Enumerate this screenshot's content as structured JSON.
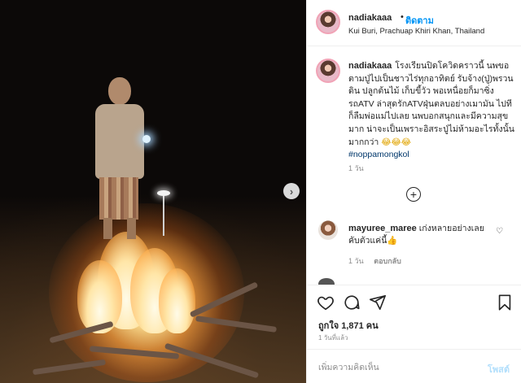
{
  "post": {
    "username": "nadiakaaa",
    "follow_label": "ติดตาม",
    "location": "Kui Buri, Prachuap Khiri Khan, Thailand",
    "caption_text": "โรงเรียนปิดโควิดคราวนี้ นพขอตามปู่ไปเป็นชาวไร่ทุกอาทิตย์ รับจ้าง(ปู่)พรวนดิน ปลูกต้นไม้ เก็บขี้วัว พอเหนื่อยก็มาซิ่งรถATV ล่าสุดรักATVฝุ่นตลบอย่างเมามัน ไปทีก็ลืมพ่อแม่ไปเลย นพบอกสนุกและมีความสุขมาก น่าจะเป็นเพราะอิสระปู่ไม่ห้ามอะไรทั้งนั้นมากกว่า",
    "caption_emoji": "😂😂😂",
    "hashtag": "#noppamongkol",
    "time_ago": "1 วัน"
  },
  "comment": {
    "username": "mayuree_maree",
    "text": "เก่งหลายอย่างเลยคับตัวแค่นี้👍",
    "time": "1 วัน",
    "reply_label": "ตอบกลับ"
  },
  "footer": {
    "likes": "ถูกใจ 1,871 คน",
    "post_time": "1 วันที่แล้ว",
    "comment_placeholder": "เพิ่มความคิดเห็น",
    "post_label": "โพสต์"
  },
  "icons": {
    "next": "chevron-right-icon",
    "load_more": "plus-circle-icon",
    "like": "heart-icon",
    "comment": "comment-icon",
    "share": "share-icon",
    "save": "bookmark-icon"
  },
  "colors": {
    "link_blue": "#0095f6",
    "hashtag": "#00376b",
    "muted": "#8e8e8e",
    "post_disabled": "#b2dffc"
  }
}
